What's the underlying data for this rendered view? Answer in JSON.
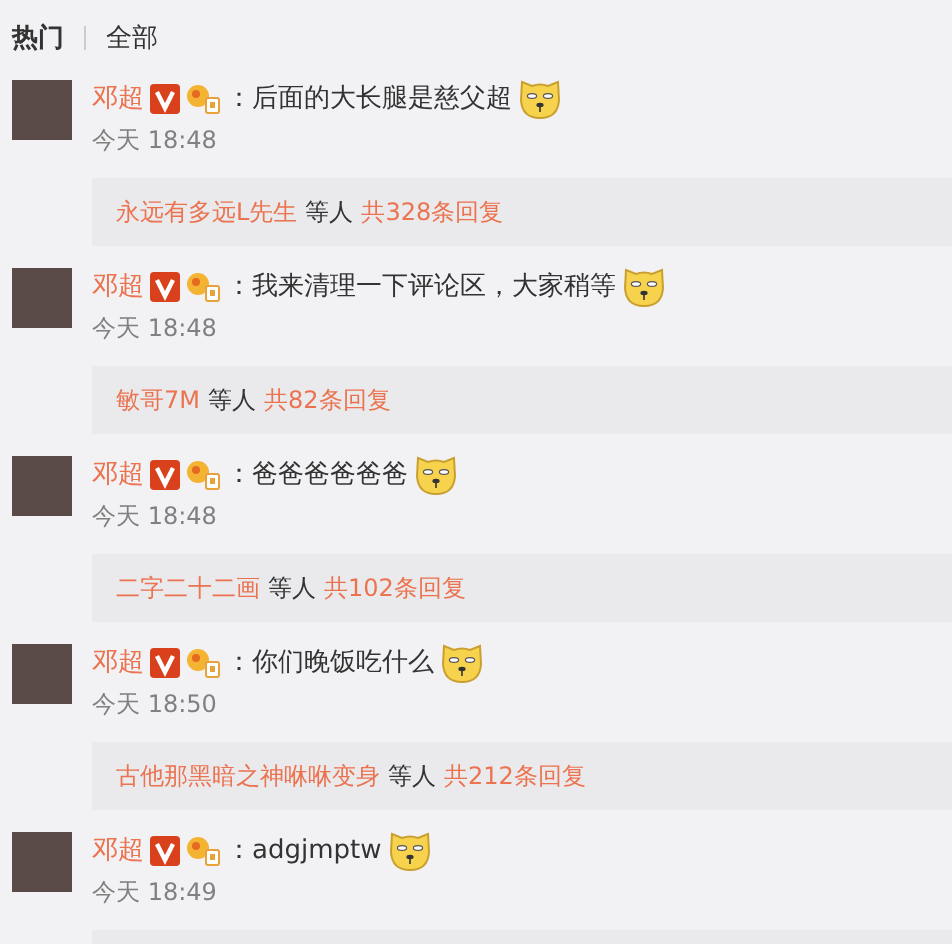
{
  "tabs": [
    {
      "label": "热门",
      "selected": true
    },
    {
      "label": "全部",
      "selected": false
    }
  ],
  "comments": [
    {
      "author": "邓超",
      "text": "：后面的大长腿是慈父超",
      "time": "今天 18:48",
      "reply": {
        "user": "永远有多远L先生",
        "others": "等人",
        "count": "共328条回复"
      }
    },
    {
      "author": "邓超",
      "text": "：我来清理一下评论区，大家稍等",
      "time": "今天 18:48",
      "reply": {
        "user": "敏哥7M",
        "others": "等人",
        "count": "共82条回复"
      }
    },
    {
      "author": "邓超",
      "text": "：爸爸爸爸爸爸",
      "time": "今天 18:48",
      "reply": {
        "user": "二字二十二画",
        "others": "等人",
        "count": "共102条回复"
      }
    },
    {
      "author": "邓超",
      "text": "：你们晚饭吃什么",
      "time": "今天 18:50",
      "reply": {
        "user": "古他那黑暗之神咻咻变身",
        "others": "等人",
        "count": "共212条回复"
      }
    },
    {
      "author": "邓超",
      "text": "：adgjmptw",
      "time": "今天 18:49"
    }
  ]
}
